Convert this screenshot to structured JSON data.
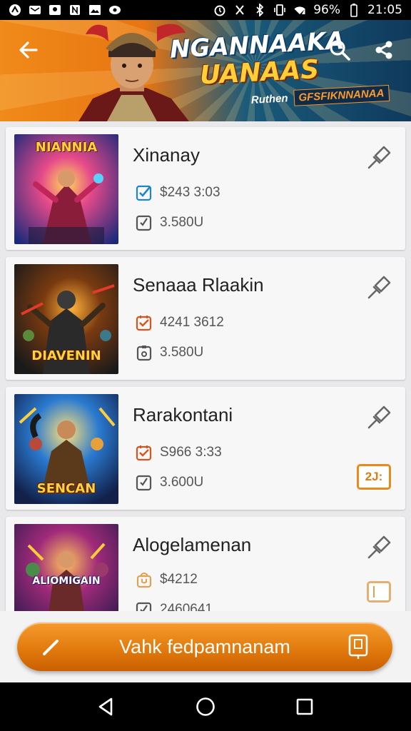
{
  "status_bar": {
    "battery": "96%",
    "time": "21:05",
    "icons": [
      "signal-icon",
      "mail-icon",
      "location-icon",
      "n-icon",
      "image-icon",
      "record-icon",
      "alarm-icon",
      "mute-icon",
      "bluetooth-icon",
      "vibrate-icon",
      "wifi-icon",
      "battery-icon"
    ]
  },
  "header": {
    "title_line1": "NGANNAAKA",
    "title_line2": "UANAAS",
    "tag_a": "Ruthen",
    "tag_b": "GFSFIKNNANAA",
    "back_icon": "arrow-left-icon",
    "search_icon": "search-icon",
    "share_icon": "share-icon"
  },
  "games": [
    {
      "name": "Xinanay",
      "thumb_title": "NIANNIA",
      "price": "$243 3:03",
      "downloads": "3.580U",
      "badge": ""
    },
    {
      "name": "Senaaa Rlaakin",
      "thumb_title": "DIAVENIN",
      "price": "4241 3612",
      "downloads": "3.580U",
      "badge": ""
    },
    {
      "name": "Rarakontani",
      "thumb_title": "SENCAN",
      "price": "S966 3:33",
      "downloads": "3.600U",
      "badge": "2J:"
    },
    {
      "name": "Alogelamenan",
      "thumb_title": "ALIOMIGAIN",
      "price": "$4212",
      "downloads": "2460641",
      "badge": ""
    }
  ],
  "cta": {
    "label": "Vahk fedpamnanam"
  },
  "colors": {
    "accent": "#e98a1d",
    "header_blue": "#0f3a5c",
    "cta_orange": "#e0780c"
  },
  "nav": {
    "back": "nav-back-icon",
    "home": "nav-home-icon",
    "recent": "nav-recent-icon"
  }
}
